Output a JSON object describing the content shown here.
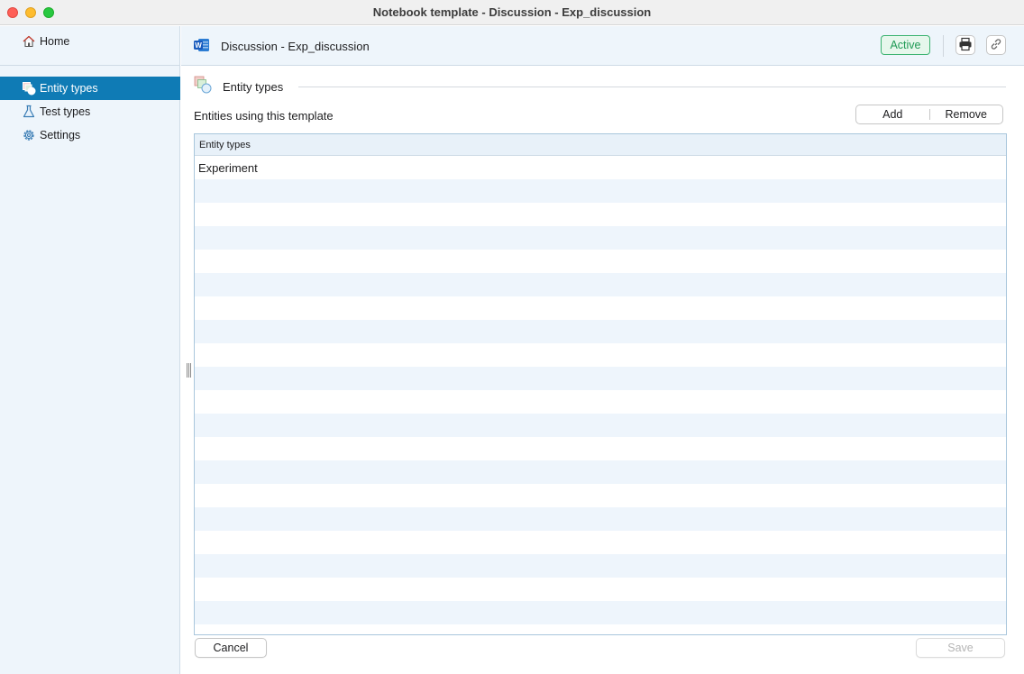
{
  "window": {
    "title": "Notebook template - Discussion - Exp_discussion"
  },
  "sidebar": {
    "home_label": "Home",
    "items": [
      {
        "label": "Entity types",
        "icon": "entity-types-icon",
        "selected": true
      },
      {
        "label": "Test types",
        "icon": "flask-icon",
        "selected": false
      },
      {
        "label": "Settings",
        "icon": "gear-icon",
        "selected": false
      }
    ]
  },
  "header": {
    "title": "Discussion - Exp_discussion",
    "status": "Active",
    "status_color": "#1f9a55",
    "accent": "#0f7bb5"
  },
  "section": {
    "title": "Entity types",
    "subtitle": "Entities using this template",
    "add_label": "Add",
    "remove_label": "Remove"
  },
  "table": {
    "column_header": "Entity types",
    "rows": [
      "Experiment"
    ]
  },
  "footer": {
    "cancel_label": "Cancel",
    "save_label": "Save"
  }
}
